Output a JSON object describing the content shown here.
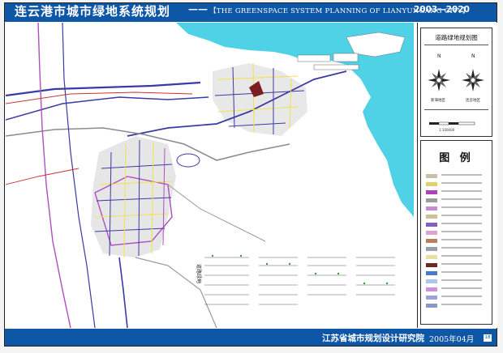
{
  "header": {
    "title_cn": "连云港市城市绿地系统规划",
    "dash": "——",
    "title_en": "【THE GREENSPACE SYSTEM PLANNING OF LIANYUNGANG CITY】",
    "years": "2003—2020"
  },
  "map": {
    "label_road": "道路绿地",
    "colors": {
      "sea": "#4fd2e6",
      "road_main": "#3a3aa8",
      "road_red": "#cc3333",
      "road_magenta": "#b04fc0",
      "road_yellow": "#f2e24a",
      "road_gray": "#9a9aa0",
      "urban_light": "#d8d8d8",
      "landmark": "#7a1f1f"
    }
  },
  "sidebar": {
    "plan_title": "道路绿地规划图",
    "compass_left": "新海地区",
    "compass_right": "连云地区",
    "north_mark": "N",
    "scale_text": "1:100000",
    "legend_title": "图  例",
    "legend_swatches": [
      "#c8c0a8",
      "#e0d070",
      "#b03fb8",
      "#9c9c9c",
      "#c88ad0",
      "#d0c090",
      "#8060c0",
      "#e0a0d0",
      "#b88060",
      "#9aa0a8",
      "#e6e0a0",
      "#6a2a20",
      "#4a7ad0",
      "#a8c8e8",
      "#d090d8",
      "#a0a0d8",
      "#8898c8"
    ]
  },
  "footer": {
    "org": "江苏省城市规划设计研究院",
    "date": "2005年04月",
    "page": "18"
  }
}
